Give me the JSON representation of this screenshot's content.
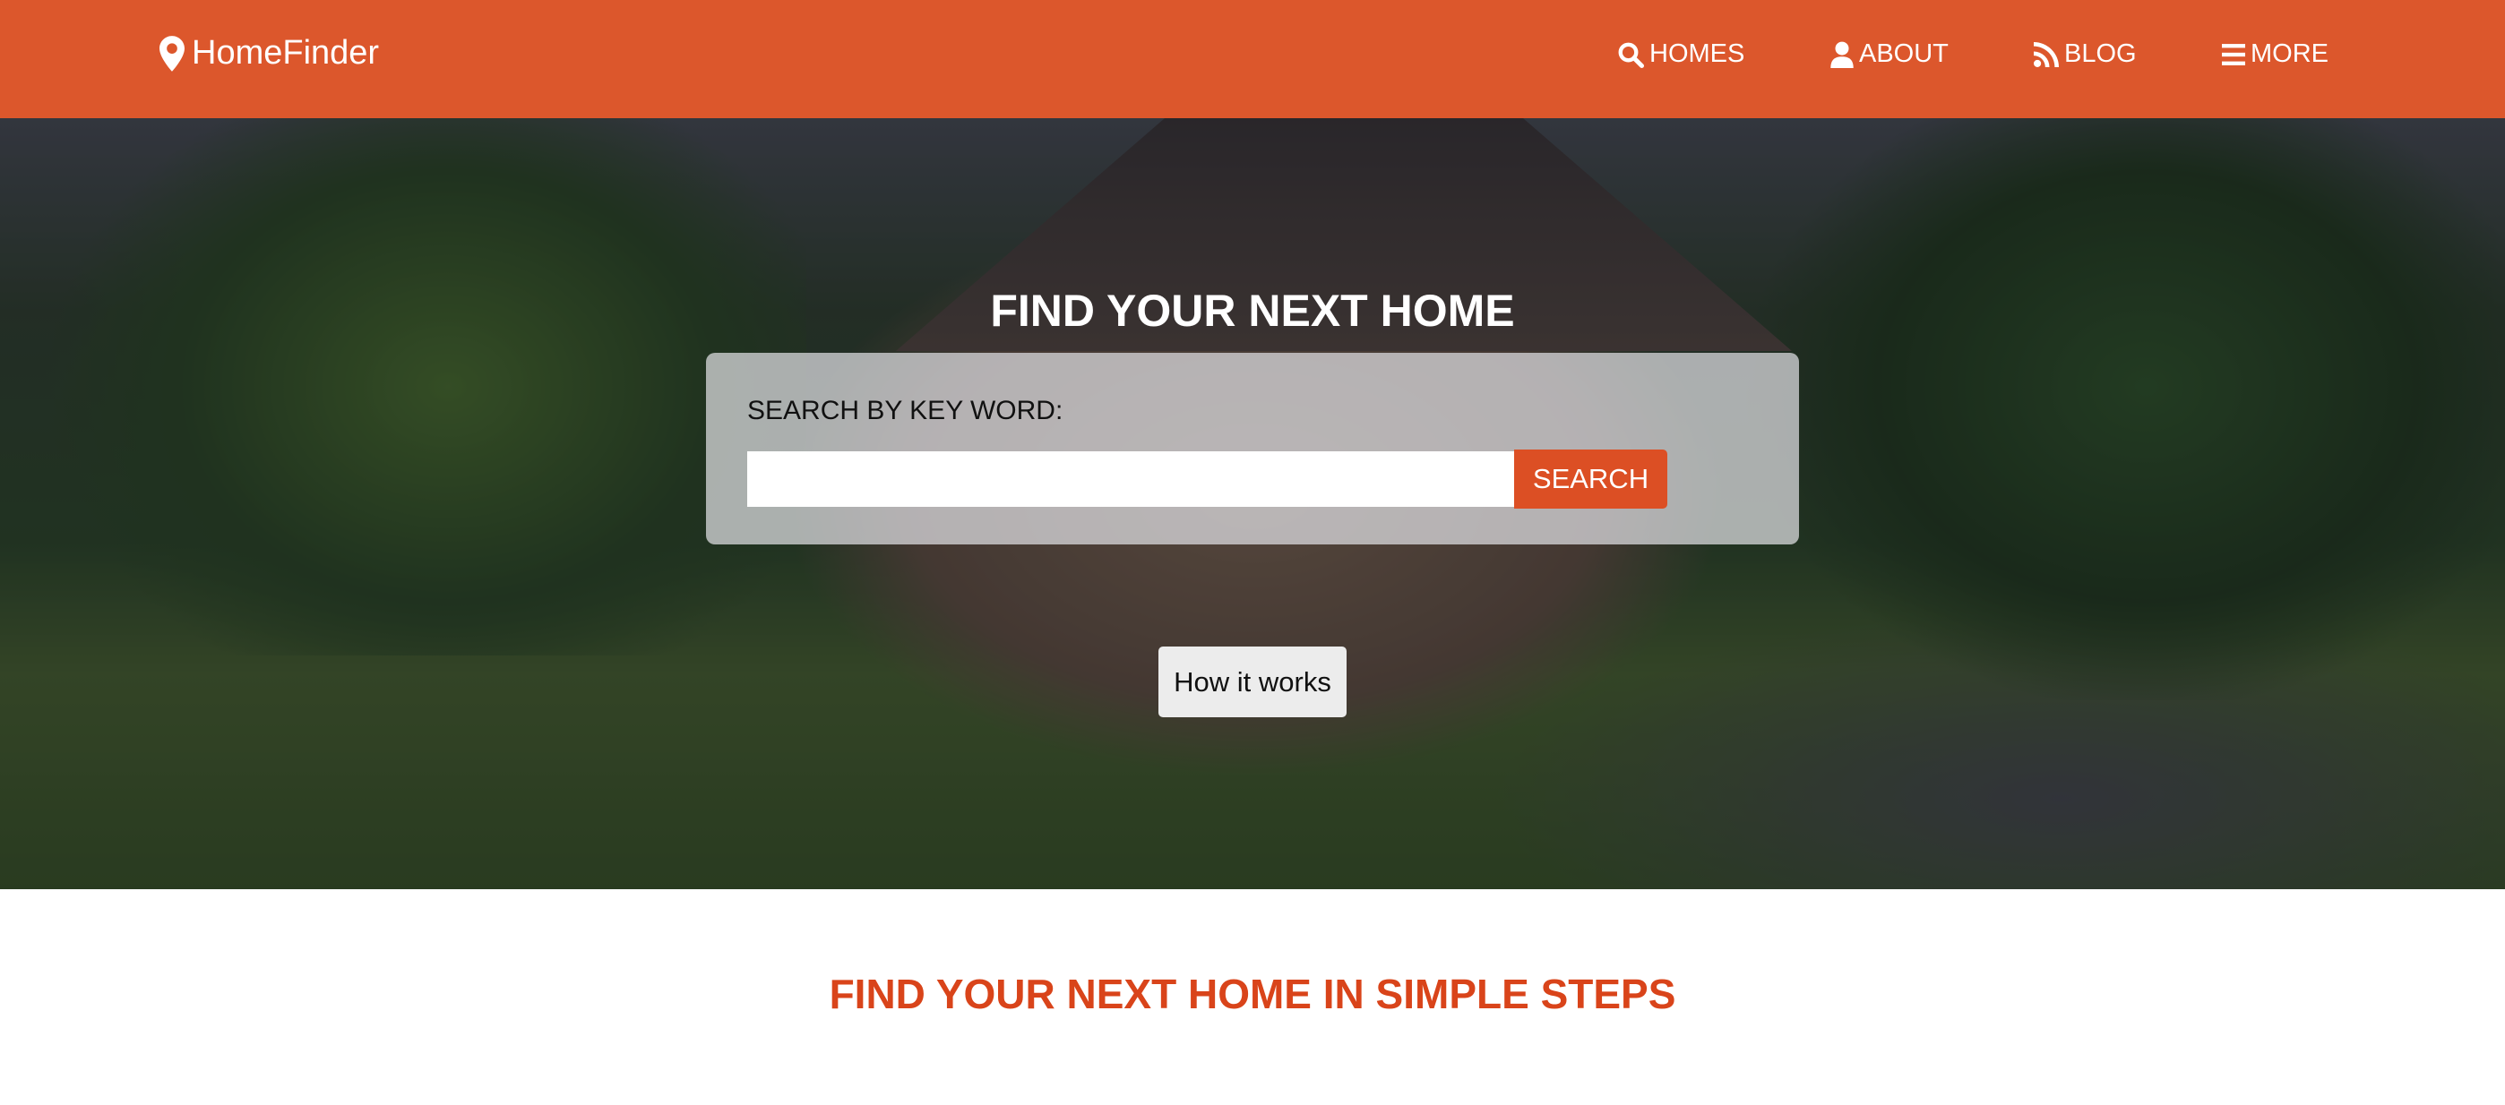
{
  "brand": {
    "name": "HomeFinder",
    "icon": "map-marker-icon",
    "accent": "#dc572c"
  },
  "nav": [
    {
      "label": "HOMES",
      "icon": "search-icon"
    },
    {
      "label": "ABOUT",
      "icon": "user-icon"
    },
    {
      "label": "BLOG",
      "icon": "rss-icon"
    },
    {
      "label": "MORE",
      "icon": "bars-icon"
    }
  ],
  "hero": {
    "title": "FIND YOUR NEXT HOME",
    "search_label": "SEARCH BY KEY WORD:",
    "search_value": "",
    "search_placeholder": "",
    "search_button": "SEARCH",
    "how_button": "How it works"
  },
  "section": {
    "heading": "FIND YOUR NEXT HOME IN SIMPLE STEPS"
  }
}
